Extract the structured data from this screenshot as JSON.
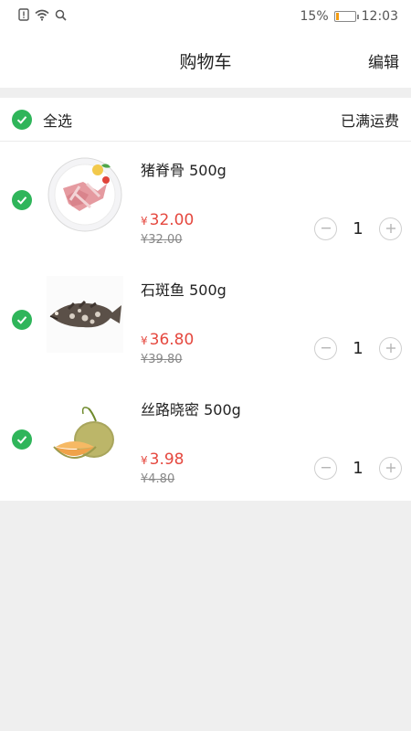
{
  "status": {
    "battery": "15%",
    "battery_level": 0.15,
    "time": "12:03"
  },
  "header": {
    "title": "购物车",
    "edit": "编辑"
  },
  "select_all": {
    "label": "全选",
    "shipping": "已满运费"
  },
  "items": [
    {
      "name": "猪脊骨 500g",
      "price_symbol": "¥",
      "price": "32.00",
      "original": "¥32.00",
      "qty": "1"
    },
    {
      "name": "石斑鱼 500g",
      "price_symbol": "¥",
      "price": "36.80",
      "original": "¥39.80",
      "qty": "1"
    },
    {
      "name": "丝路晓密 500g",
      "price_symbol": "¥",
      "price": "3.98",
      "original": "¥4.80",
      "qty": "1"
    }
  ],
  "colors": {
    "accent_green": "#2fb55a",
    "price_red": "#e5483f",
    "battery_orange": "#f39c12"
  }
}
